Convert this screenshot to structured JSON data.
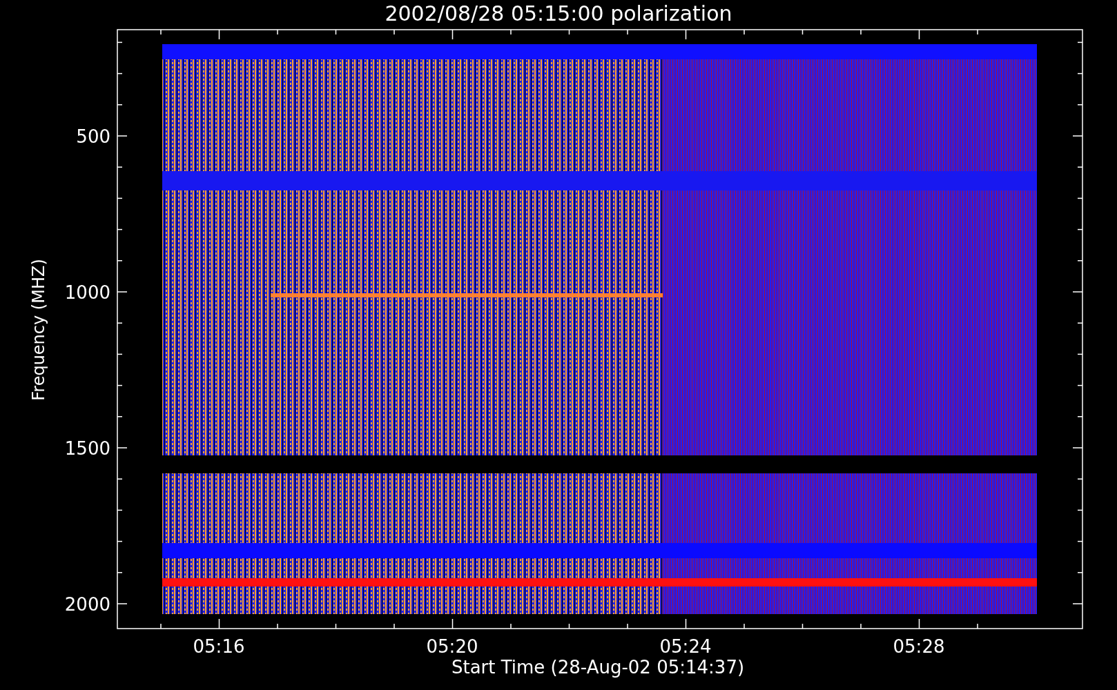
{
  "title": "2002/08/28 05:15:00 polarization",
  "x_axis": {
    "label": "Start Time (28-Aug-02 05:14:37)",
    "ticks": [
      "05:16",
      "05:20",
      "05:24",
      "05:28"
    ]
  },
  "y_axis": {
    "label": "Frequency (MHZ)",
    "ticks": [
      "500",
      "1000",
      "1500",
      "2000"
    ]
  }
}
